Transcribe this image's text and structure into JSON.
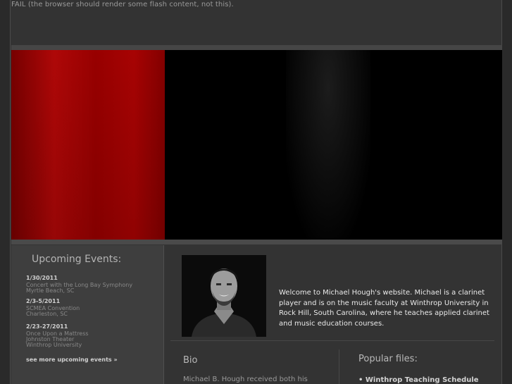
{
  "flash_fail_text": "FAIL (the browser should render some flash content, not this).",
  "sidebar": {
    "title": "Upcoming Events:",
    "events": [
      {
        "date": "1/30/2011",
        "lines": [
          "Concert with the Long Bay Symphony",
          "Myrtle Beach, SC"
        ]
      },
      {
        "date": "2/3-5/2011",
        "lines": [
          "SCMEA Convention",
          "Charleston, SC"
        ]
      },
      {
        "date": "2/23-27/2011",
        "lines": [
          "Once Upon a Mattress",
          "Johnston Theater",
          "Winthrop University"
        ]
      }
    ],
    "see_more_label": "see more upcoming events",
    "see_more_icon": "double-chevron-right-icon"
  },
  "main": {
    "welcome_text": "Welcome to Michael Hough's website.  Michael is a clarinet player and is on the music faculty at Winthrop University in Rock Hill, South Carolina, where he teaches applied clarinet and music education courses.",
    "bio_title": "Bio",
    "bio_text": "Michael B. Hough received both his",
    "popular_title": "Popular files:",
    "popular_files": [
      "Winthrop Teaching Schedule"
    ]
  },
  "colors": {
    "page_bg": "#333333",
    "banner_red": "#b80808",
    "sidebar_bg": "#3e3e3e"
  }
}
